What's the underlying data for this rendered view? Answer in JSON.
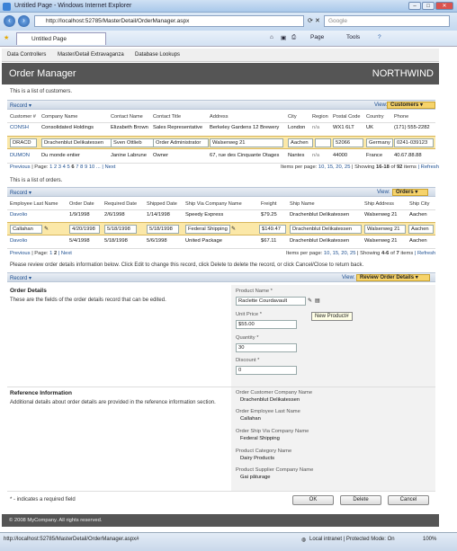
{
  "window": {
    "title": "Untitled Page - Windows Internet Explorer",
    "minimize": "–",
    "maximize": "□",
    "close": "✕"
  },
  "browser": {
    "url": "http://localhost:52785/MasterDetail/OrderManager.aspx",
    "search_placeholder": "Google",
    "tab_title": "Untitled Page",
    "page_menu": "Page",
    "tools_menu": "Tools"
  },
  "menu": [
    "Data Controllers",
    "Master/Detail Extravaganza",
    "Database Lookups"
  ],
  "header": {
    "title": "Order Manager",
    "brand": "NORTHWIND"
  },
  "customers": {
    "intro": "This is a list of customers.",
    "record": "Record",
    "view_label": "View:",
    "view": "Customers",
    "columns": [
      "Customer #",
      "Company Name",
      "Contact Name",
      "Contact Title",
      "Address",
      "City",
      "Region",
      "Postal Code",
      "Country",
      "Phone"
    ],
    "rows": [
      [
        "CONSH",
        "Consolidated Holdings",
        "Elizabeth Brown",
        "Sales Representative",
        "Berkeley Gardens 12 Brewery",
        "London",
        "n/a",
        "WX1 6LT",
        "UK",
        "(171) 555-2282"
      ],
      [
        "DRACD",
        "Drachenblut Delikatessen",
        "Sven Ottlieb",
        "Order Administrator",
        "Walserweg 21",
        "Aachen",
        "",
        "52066",
        "Germany",
        "0241-039123"
      ],
      [
        "DUMON",
        "Du monde entier",
        "Janine Labrune",
        "Owner",
        "67, rue des Cinquante Otages",
        "Nantes",
        "n/a",
        "44000",
        "France",
        "40.67.88.88"
      ]
    ],
    "pager": {
      "previous": "Previous",
      "page_label": "| Page:",
      "pages": [
        "1",
        "2",
        "3",
        "4",
        "5",
        "6",
        "7",
        "8",
        "9",
        "10",
        "..."
      ],
      "current": "6",
      "next": "| Next",
      "items_per_page": "Items per page:",
      "sizes": [
        "10,",
        "15,",
        "20,",
        "25"
      ],
      "showing_prefix": "| Showing",
      "showing_range": "16-18",
      "of": "of",
      "total": "92",
      "items": "items",
      "refresh": "| Refresh"
    }
  },
  "orders": {
    "intro": "This is a list of orders.",
    "record": "Record",
    "view_label": "View:",
    "view": "Orders",
    "columns": [
      "Employee Last Name",
      "Order Date",
      "Required Date",
      "Shipped Date",
      "Ship Via Company Name",
      "Freight",
      "Ship Name",
      "Ship Address",
      "Ship City"
    ],
    "rows": [
      [
        "Davolio",
        "1/9/1998",
        "2/6/1998",
        "1/14/1998",
        "Speedy Express",
        "$79.25",
        "Drachenblut Delikatessen",
        "Walserweg 21",
        "Aachen"
      ],
      [
        "Callahan",
        "4/20/1998",
        "5/18/1998",
        "5/18/1998",
        "Federal Shipping",
        "$149.47",
        "Drachenblut Delikatessen",
        "Walserweg 21",
        "Aachen"
      ],
      [
        "Davolio",
        "5/4/1998",
        "5/18/1998",
        "5/6/1998",
        "United Package",
        "$67.11",
        "Drachenblut Delikatessen",
        "Walserweg 21",
        "Aachen"
      ]
    ],
    "pager": {
      "previous": "Previous",
      "page_label": "| Page:",
      "pages": [
        "1",
        "2"
      ],
      "next": "| Next",
      "items_per_page": "Items per page:",
      "sizes": [
        "10,",
        "15,",
        "20,",
        "25"
      ],
      "showing_prefix": "| Showing",
      "showing_range": "4-6",
      "of": "of",
      "total": "7",
      "items": "items",
      "refresh": "| Refresh"
    },
    "review_note": "Please review order details information below. Click Edit to change this record, click Delete to delete the record, or click Cancel/Close to return back."
  },
  "details": {
    "record": "Record",
    "view_label": "View:",
    "view": "Review Order Details",
    "section_title": "Order Details",
    "section_desc": "These are the fields of the order details record that can be edited.",
    "product_label": "Product Name *",
    "product_value": "Raclette Courdavault",
    "new_product": "New Product#",
    "price_label": "Unit Price *",
    "price_value": "$55.00",
    "qty_label": "Quantity *",
    "qty_value": "30",
    "discount_label": "Discount *",
    "discount_value": "0",
    "ref_title": "Reference Information",
    "ref_desc": "Additional details about order details are provided in the reference information section.",
    "refs": [
      {
        "label": "Order Customer Company Name",
        "value": "Drachenblut Delikatessen"
      },
      {
        "label": "Order Employee Last Name",
        "value": "Callahan"
      },
      {
        "label": "Order Ship Via Company Name",
        "value": "Federal Shipping"
      },
      {
        "label": "Product Category Name",
        "value": "Dairy Products"
      },
      {
        "label": "Product Supplier Company Name",
        "value": "Gai pâturage"
      }
    ],
    "required_note": "* - indicates a required field",
    "ok": "OK",
    "delete": "Delete",
    "cancel": "Cancel"
  },
  "footer": "© 2008 MyCompany. All rights reserved.",
  "status": {
    "url": "http://localhost:52785/MasterDetail/OrderManager.aspx#",
    "zone": "Local intranet | Protected Mode: On",
    "zoom": "100%"
  }
}
